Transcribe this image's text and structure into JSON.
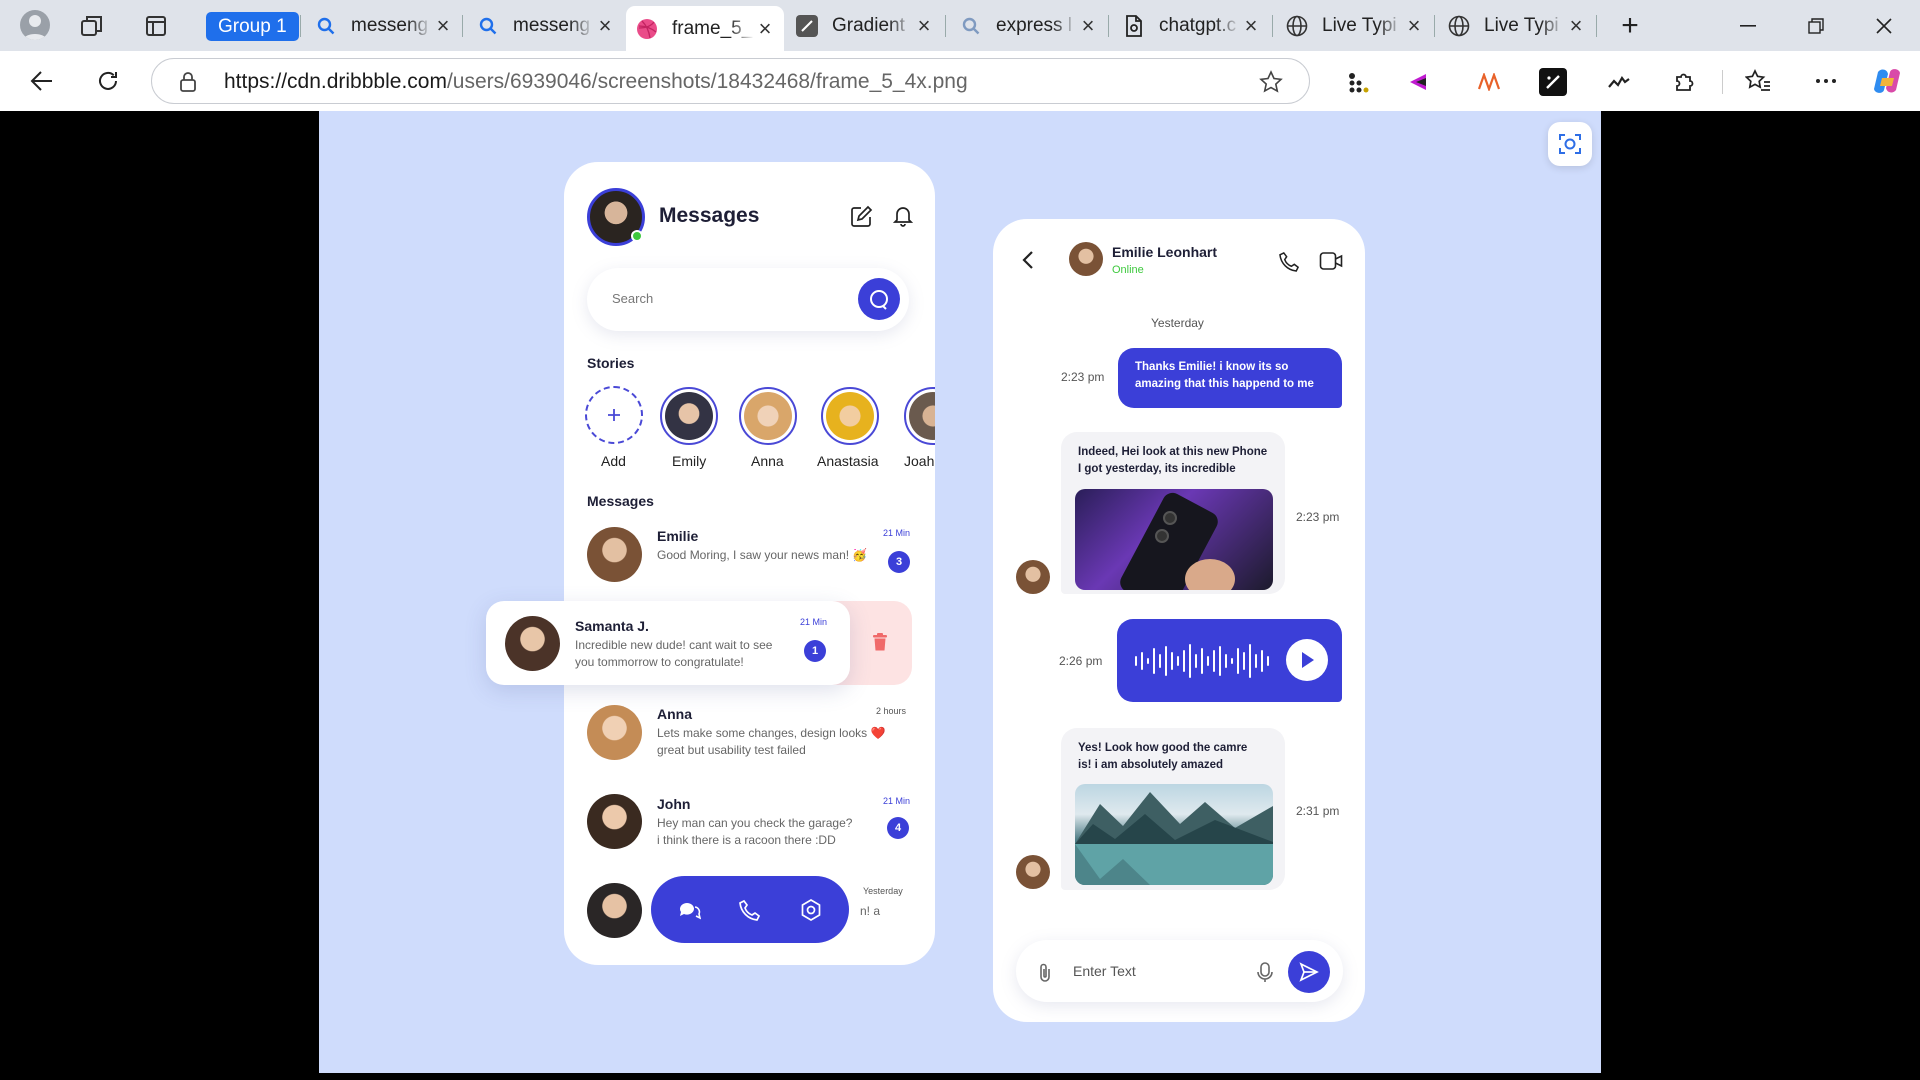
{
  "browser": {
    "group_label": "Group 1",
    "tabs": [
      {
        "title": "messeng",
        "icon": "search-icon"
      },
      {
        "title": "messeng",
        "icon": "search-icon"
      },
      {
        "title": "frame_5_",
        "icon": "dribbble-icon"
      },
      {
        "title": "Gradient",
        "icon": "gradient-site-icon"
      },
      {
        "title": "express l",
        "icon": "search-icon"
      },
      {
        "title": "chatgpt.c",
        "icon": "document-icon"
      },
      {
        "title": "Live Typi",
        "icon": "globe-icon"
      },
      {
        "title": "Live Typi",
        "icon": "globe-icon"
      }
    ],
    "url_host": "https://cdn.dribbble.com",
    "url_path": "/users/6939046/screenshots/18432468/frame_5_4x.png"
  },
  "left_phone": {
    "title": "Messages",
    "search_placeholder": "Search",
    "stories_heading": "Stories",
    "stories": [
      {
        "name": "Add"
      },
      {
        "name": "Emily"
      },
      {
        "name": "Anna"
      },
      {
        "name": "Anastasia"
      },
      {
        "name": "Joah"
      }
    ],
    "messages_heading": "Messages",
    "conversations": [
      {
        "name": "Emilie",
        "preview": "Good Moring, I saw your news man! 🥳",
        "time": "21 Min",
        "unread": "3"
      },
      {
        "name": "Samanta J.",
        "preview_1": "Incredible new dude! cant wait to see",
        "preview_2": "you tommorrow to congratulate!",
        "time": "21 Min",
        "unread": "1"
      },
      {
        "name": "Anna",
        "preview_1": "Lets make some changes, design looks ❤️",
        "preview_2": "great but usability test failed",
        "time": "2 hours"
      },
      {
        "name": "John",
        "preview_1": "Hey man can you check the garage?",
        "preview_2": "i think there is a racoon there :DD",
        "time": "21 Min",
        "unread": "4"
      },
      {
        "time": "Yesterday",
        "preview": "n! a"
      }
    ]
  },
  "right_phone": {
    "contact_name": "Emilie Leonhart",
    "status": "Online",
    "date_divider": "Yesterday",
    "messages": [
      {
        "dir": "out",
        "time": "2:23 pm",
        "text_1": "Thanks Emilie! i know its so",
        "text_2": "amazing that this happend to me"
      },
      {
        "dir": "in",
        "time": "2:23 pm",
        "text_1": "Indeed, Hei look at this new Phone",
        "text_2": "I got yesterday, its incredible"
      },
      {
        "dir": "out",
        "time": "2:26 pm",
        "kind": "voice"
      },
      {
        "dir": "in",
        "time": "2:31 pm",
        "text_1": "Yes! Look how good the camre",
        "text_2": "is! i am absolutely amazed"
      }
    ],
    "input_placeholder": "Enter Text"
  },
  "colors": {
    "accent": "#3b3fd8",
    "canvas_bg": "#cfdcfc",
    "online": "#3ec93e",
    "delete": "#f06a6a"
  }
}
